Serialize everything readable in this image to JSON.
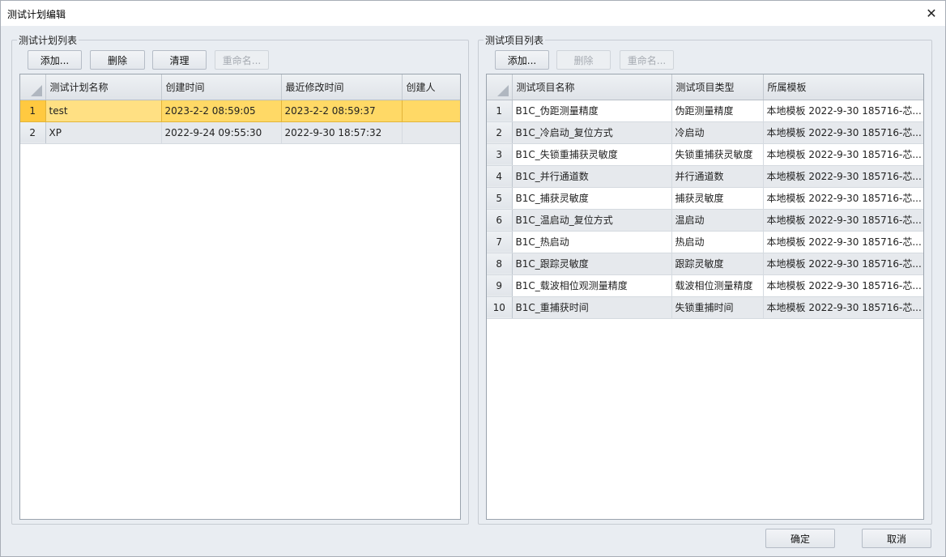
{
  "window": {
    "title": "测试计划编辑",
    "close_glyph": "✕"
  },
  "plan_group": {
    "title": "测试计划列表",
    "buttons": {
      "add": "添加...",
      "delete": "删除",
      "clear": "清理",
      "rename": "重命名..."
    },
    "columns": [
      "测试计划名称",
      "创建时间",
      "最近修改时间",
      "创建人"
    ],
    "rows": [
      {
        "num": "1",
        "name": "test",
        "created": "2023-2-2 08:59:05",
        "modified": "2023-2-2 08:59:37",
        "creator": ""
      },
      {
        "num": "2",
        "name": "XP",
        "created": "2022-9-24 09:55:30",
        "modified": "2022-9-30 18:57:32",
        "creator": ""
      }
    ],
    "selected_row": 0
  },
  "item_group": {
    "title": "测试项目列表",
    "buttons": {
      "add": "添加...",
      "delete": "删除",
      "rename": "重命名..."
    },
    "columns": [
      "测试项目名称",
      "测试项目类型",
      "所属模板"
    ],
    "rows": [
      {
        "num": "1",
        "name": "B1C_伪距测量精度",
        "type": "伪距测量精度",
        "template": "本地模板 2022-9-30 185716-芯..."
      },
      {
        "num": "2",
        "name": "B1C_冷启动_复位方式",
        "type": "冷启动",
        "template": "本地模板 2022-9-30 185716-芯..."
      },
      {
        "num": "3",
        "name": "B1C_失锁重捕获灵敏度",
        "type": "失锁重捕获灵敏度",
        "template": "本地模板 2022-9-30 185716-芯..."
      },
      {
        "num": "4",
        "name": "B1C_并行通道数",
        "type": "并行通道数",
        "template": "本地模板 2022-9-30 185716-芯..."
      },
      {
        "num": "5",
        "name": "B1C_捕获灵敏度",
        "type": "捕获灵敏度",
        "template": "本地模板 2022-9-30 185716-芯..."
      },
      {
        "num": "6",
        "name": "B1C_温启动_复位方式",
        "type": "温启动",
        "template": "本地模板 2022-9-30 185716-芯..."
      },
      {
        "num": "7",
        "name": "B1C_热启动",
        "type": "热启动",
        "template": "本地模板 2022-9-30 185716-芯..."
      },
      {
        "num": "8",
        "name": "B1C_跟踪灵敏度",
        "type": "跟踪灵敏度",
        "template": "本地模板 2022-9-30 185716-芯..."
      },
      {
        "num": "9",
        "name": "B1C_载波相位观测量精度",
        "type": "载波相位测量精度",
        "template": "本地模板 2022-9-30 185716-芯..."
      },
      {
        "num": "10",
        "name": "B1C_重捕获时间",
        "type": "失锁重捕时间",
        "template": "本地模板 2022-9-30 185716-芯..."
      }
    ]
  },
  "footer": {
    "ok": "确定",
    "cancel": "取消"
  }
}
